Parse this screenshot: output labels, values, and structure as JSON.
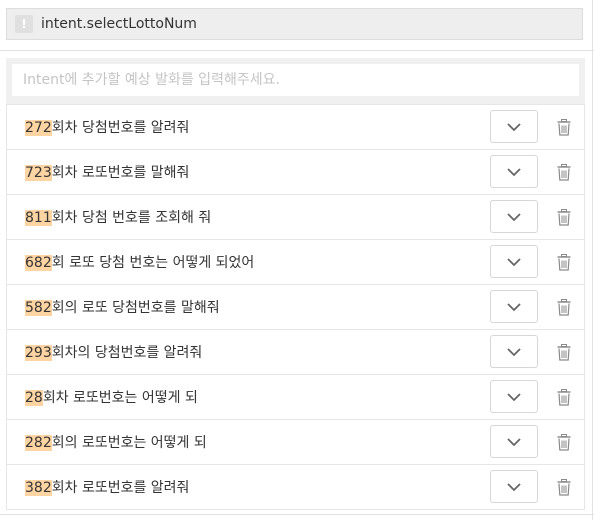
{
  "intent": {
    "badge": "!",
    "name": "intent.selectLottoNum"
  },
  "input": {
    "placeholder": "Intent에 추가할 예상 발화를 입력해주세요.",
    "value": ""
  },
  "utterances": [
    {
      "slot": "272",
      "text": "회차 당첨번호를 알려줘"
    },
    {
      "slot": "723",
      "text": "회차 로또번호를 말해줘"
    },
    {
      "slot": "811",
      "text": "회차 당첨 번호를 조회해 줘"
    },
    {
      "slot": "682",
      "text": "회 로또 당첨 번호는 어떻게 되었어"
    },
    {
      "slot": "582",
      "text": "회의 로또 당첨번호를 말해줘"
    },
    {
      "slot": "293",
      "text": "회차의 당첨번호를 알려줘"
    },
    {
      "slot": "28",
      "text": "회차 로또번호는 어떻게 되"
    },
    {
      "slot": "282",
      "text": "회의 로또번호는 어떻게 되"
    },
    {
      "slot": "382",
      "text": "회차 로또번호를 알려줘"
    }
  ],
  "icons": {
    "expand": "chevron-down-icon",
    "delete": "trash-icon"
  },
  "colors": {
    "slot_highlight": "#ffd4a3",
    "header_bg": "#eeeeee"
  }
}
